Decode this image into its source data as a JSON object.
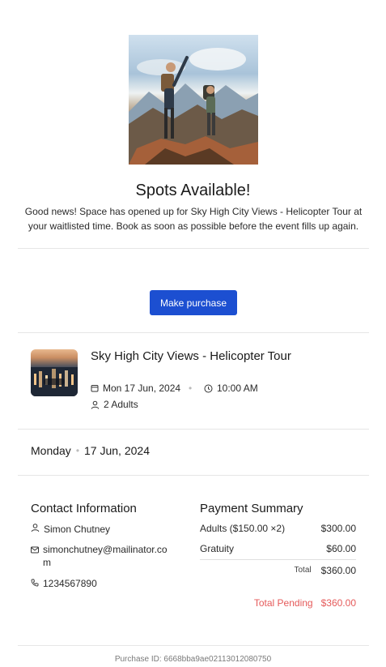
{
  "header": {
    "heading": "Spots Available!",
    "message": "Good news! Space has opened up for Sky High City Views - Helicopter Tour at your waitlisted time. Book as soon as possible before the event fills up again."
  },
  "actions": {
    "purchase_label": "Make purchase"
  },
  "event": {
    "title": "Sky High City Views - Helicopter Tour",
    "date": "Mon 17 Jun, 2024",
    "time": "10:00 AM",
    "guests": "2 Adults"
  },
  "date_row": {
    "weekday": "Monday",
    "date": "17 Jun, 2024"
  },
  "contact": {
    "title": "Contact Information",
    "name": "Simon Chutney",
    "email": "simonchutney@mailinator.com",
    "phone": "1234567890"
  },
  "payment": {
    "title": "Payment Summary",
    "lines": [
      {
        "label": "Adults ($150.00 ×2)",
        "amount": "$300.00"
      },
      {
        "label": "Gratuity",
        "amount": "$60.00"
      }
    ],
    "total_label": "Total",
    "total_amount": "$360.00",
    "pending_label": "Total Pending",
    "pending_amount": "$360.00"
  },
  "footer": {
    "purchase_id": "Purchase ID: 6668bba9ae02113012080750"
  },
  "colors": {
    "accent": "#1c4fd1",
    "pending": "#e55a5a"
  }
}
